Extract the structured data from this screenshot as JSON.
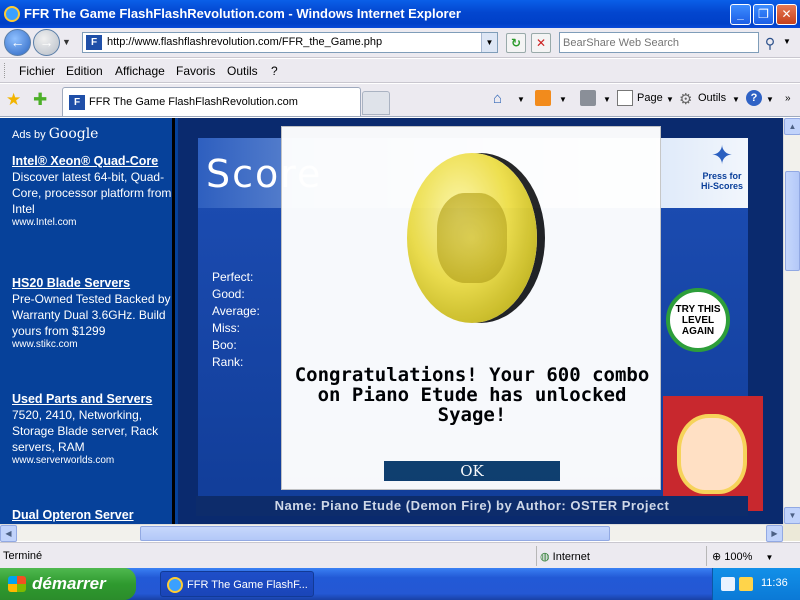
{
  "window": {
    "title": "FFR The Game FlashFlashRevolution.com - Windows Internet Explorer",
    "minimize": "_",
    "maximize": "❐",
    "close": "✕"
  },
  "address": {
    "url": "http://www.flashflashrevolution.com/FFR_the_Game.php",
    "search_placeholder": "BearShare Web Search"
  },
  "menu": {
    "items": [
      "Fichier",
      "Edition",
      "Affichage",
      "Favoris",
      "Outils",
      "?"
    ]
  },
  "tabs": {
    "active_label": "FFR The Game FlashFlashRevolution.com"
  },
  "command_bar": {
    "page": "Page",
    "tools": "Outils"
  },
  "ads": {
    "header_prefix": "Ads by",
    "header_brand": "Google",
    "items": [
      {
        "title": "Intel® Xeon® Quad-Core",
        "desc": "Discover latest 64-bit, Quad-Core, processor platform from Intel",
        "url": "www.Intel.com"
      },
      {
        "title": "HS20 Blade Servers",
        "desc": "Pre-Owned Tested Backed by Warranty Dual 3.6GHz. Build yours from $1299",
        "url": "www.stikc.com"
      },
      {
        "title": "Used Parts and Servers",
        "desc": "7520, 2410, Networking, Storage Blade server, Rack servers, RAM",
        "url": "www.serverworlds.com"
      },
      {
        "title": "Dual Opteron Server",
        "desc": "",
        "url": ""
      }
    ]
  },
  "game": {
    "score_title": "Score",
    "stats": [
      "Perfect:",
      "Good:",
      "Average:",
      "Miss:",
      "Boo:",
      "Rank:"
    ],
    "press_for": "Press for Hi-Scores",
    "try_this_level": "TRY THIS LEVEL AGAIN",
    "song_line": "Name: Piano Etude (Demon Fire) by Author: OSTER Project"
  },
  "dialog": {
    "message": "Congratulations!  Your 600 combo on Piano Etude has unlocked Syage!",
    "ok": "OK"
  },
  "status": {
    "text": "Terminé",
    "zone": "Internet",
    "zoom": "100%"
  },
  "taskbar": {
    "start": "démarrer",
    "window_button": "FFR The Game FlashF...",
    "clock": "11:36"
  }
}
